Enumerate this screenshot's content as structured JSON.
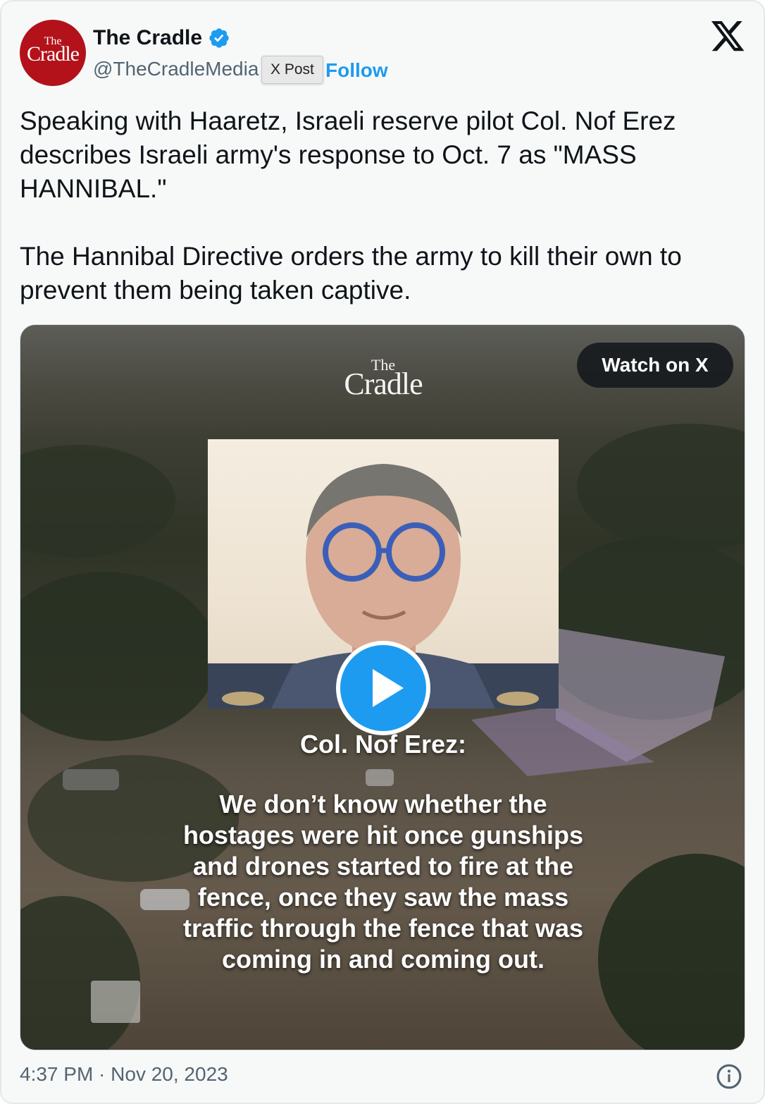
{
  "author": {
    "name": "The Cradle",
    "handle": "@TheCradleMedia",
    "follow_label": "Follow",
    "avatar_logo_small": "The",
    "avatar_logo_big": "Cradle",
    "verified_icon": "verified-badge-icon"
  },
  "tooltip": "X Post",
  "tweet": {
    "paragraph1": "Speaking with Haaretz, Israeli reserve pilot Col. Nof Erez describes Israeli army's response to Oct. 7 as \"MASS HANNIBAL.\"",
    "paragraph2": "The Hannibal Directive orders the army to kill their own to prevent them being taken captive."
  },
  "video": {
    "watch_label": "Watch on X",
    "logo_small": "The",
    "logo_big": "Cradle",
    "speaker": "Col. Nof Erez:",
    "quote": "We don’t know whether the hostages were hit once gunships and drones started to fire at the fence, once they saw the mass traffic through the fence that was coming in and coming out."
  },
  "footer": {
    "timestamp": "4:37 PM · Nov 20, 2023"
  },
  "colors": {
    "accent": "#1d9bf0",
    "avatar_bg": "#b3121a",
    "muted_text": "#536471"
  }
}
